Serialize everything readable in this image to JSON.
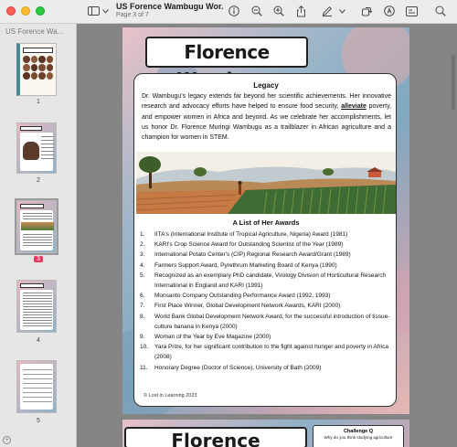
{
  "window": {
    "doc_title": "US Forence Wambugu Wor...",
    "page_indicator": "Page 3 of 7"
  },
  "toolbar": {
    "icons": [
      "sidebar-icon",
      "chevron-down-icon",
      "info-icon",
      "zoom-out-icon",
      "zoom-in-icon",
      "share-icon",
      "markup-pen-icon",
      "chevron-down-icon",
      "rotate-icon",
      "annotate-icon",
      "form-icon",
      "search-icon"
    ]
  },
  "sidebar": {
    "title": "US Forence Wa...",
    "thumbnails": [
      {
        "num": "1",
        "selected": false
      },
      {
        "num": "2",
        "selected": false
      },
      {
        "num": "3",
        "selected": true
      },
      {
        "num": "4",
        "selected": false
      },
      {
        "num": "5",
        "selected": false
      }
    ]
  },
  "page": {
    "title": "Florence Wambugu",
    "legacy_heading": "Legacy",
    "legacy_text_1": "Dr. Wambugu's legacy extends far beyond her scientific achievements. Her innovative research and advocacy efforts have helped to ensure food security, ",
    "legacy_underlined": "alleviate",
    "legacy_text_2": " poverty, and empower women in Africa and beyond. As we celebrate her accomplishments, let us honor Dr. Florence Muringi Wambugu as a trailblazer in African agriculture and a champion for women in STEM.",
    "awards_heading": "A List of Her Awards",
    "awards": [
      {
        "n": "1.",
        "text": "IITA's (International Institute of Tropical Agriculture, Nigeria) Award (1981)"
      },
      {
        "n": "2.",
        "text": "KARI's Crop Science Award for Outstanding Scientist of the Year (1989)"
      },
      {
        "n": "3.",
        "text": "International Potato Center's (CIP) Regional Research Award/Grant (1989)"
      },
      {
        "n": "4.",
        "text": "Farmers Support Award, Pyrethrum Marketing Board of Kenya (1990)"
      },
      {
        "n": "5.",
        "text": "Recognized as an exemplary PhD candidate, Virology Division of Horticultural Research International in England and KARI (1991)"
      },
      {
        "n": "6.",
        "text": "Monsanto Company Outstanding Performance Award (1992, 1993)"
      },
      {
        "n": "7.",
        "text": "First Place Winner, Global Development Network Awards, KARI (2000)"
      },
      {
        "n": "8.",
        "text": "World Bank Global Development Network Award, for the successful introduction of tissue-culture banana in Kenya (2000)"
      },
      {
        "n": "9.",
        "text": "Woman of the Year by Eve Magazine (2000)"
      },
      {
        "n": "10.",
        "text": "Yara Prize, for her significant contribution to the fight against hunger and poverty in Africa (2008)"
      },
      {
        "n": "11.",
        "text": "Honorary Degree (Doctor of Science), University of Bath (2009)"
      }
    ],
    "copyright": "© Lost in Learning 2023"
  },
  "next_page": {
    "title": "Florence Wambugu",
    "challenge_heading": "Challenge Q",
    "challenge_text": "Why do you think studying agriculture"
  }
}
